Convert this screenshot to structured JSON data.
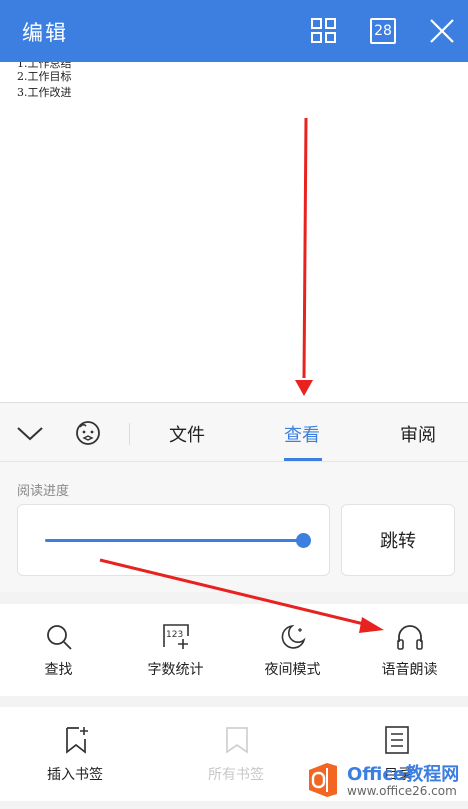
{
  "topbar": {
    "title": "编辑",
    "page_count": "28"
  },
  "document": {
    "lines": [
      "1.工作总结",
      "2.工作目标",
      "3.工作改进"
    ]
  },
  "tabs": {
    "items": [
      {
        "label": "文件",
        "active": false
      },
      {
        "label": "查看",
        "active": true
      },
      {
        "label": "审阅",
        "active": false
      }
    ]
  },
  "progress": {
    "label": "阅读进度",
    "value": 1.0,
    "jump_label": "跳转"
  },
  "tools": [
    {
      "label": "查找",
      "icon": "search-icon"
    },
    {
      "label": "字数统计",
      "icon": "word-count-icon"
    },
    {
      "label": "夜间模式",
      "icon": "night-mode-icon"
    },
    {
      "label": "语音朗读",
      "icon": "headphones-icon"
    }
  ],
  "bookmarks": [
    {
      "label": "插入书签",
      "icon": "bookmark-add-icon",
      "enabled": true
    },
    {
      "label": "所有书签",
      "icon": "bookmark-icon",
      "enabled": false
    },
    {
      "label": "目录",
      "icon": "table-of-contents-icon",
      "enabled": true
    }
  ],
  "watermark": {
    "brand": "Office教程网",
    "url": "www.office26.com"
  },
  "colors": {
    "accent": "#3d7fe0",
    "annotation_arrow": "#e8231f",
    "watermark_orange": "#f26522"
  }
}
